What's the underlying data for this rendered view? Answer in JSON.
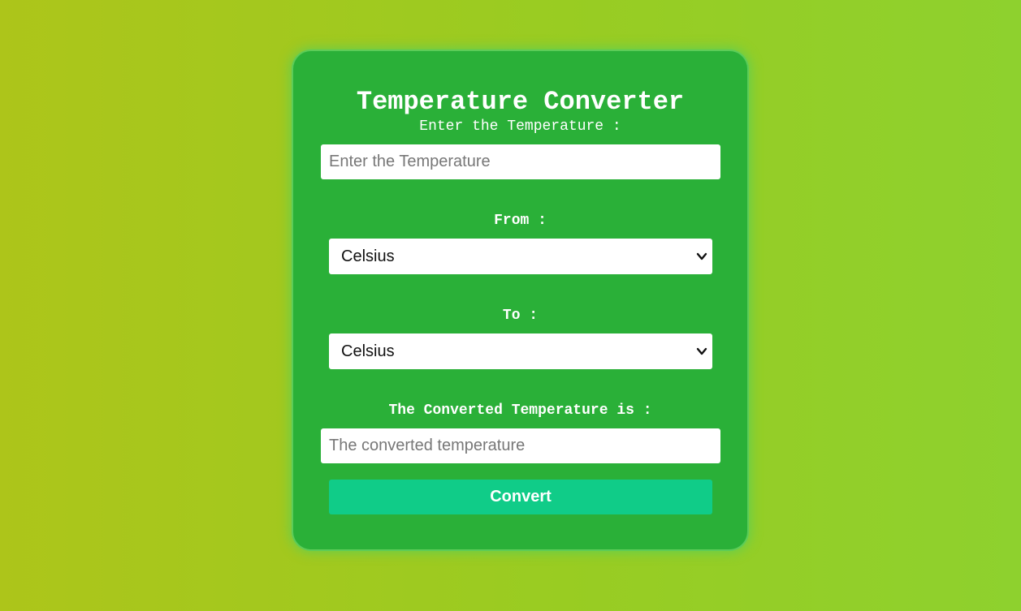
{
  "converter": {
    "title": "Temperature Converter",
    "input_label": "Enter the Temperature :",
    "input_placeholder": "Enter the Temperature",
    "input_value": "",
    "from_label": "From :",
    "from_selected": "Celsius",
    "to_label": "To :",
    "to_selected": "Celsius",
    "result_label": "The Converted Temperature is :",
    "result_placeholder": "The converted temperature",
    "result_value": "",
    "convert_button": "Convert"
  },
  "icons": {
    "dropdown": "chevron-down-icon"
  },
  "colors": {
    "card_background": "#2ab038",
    "button_background": "#10cc88",
    "text": "#ffffff"
  }
}
